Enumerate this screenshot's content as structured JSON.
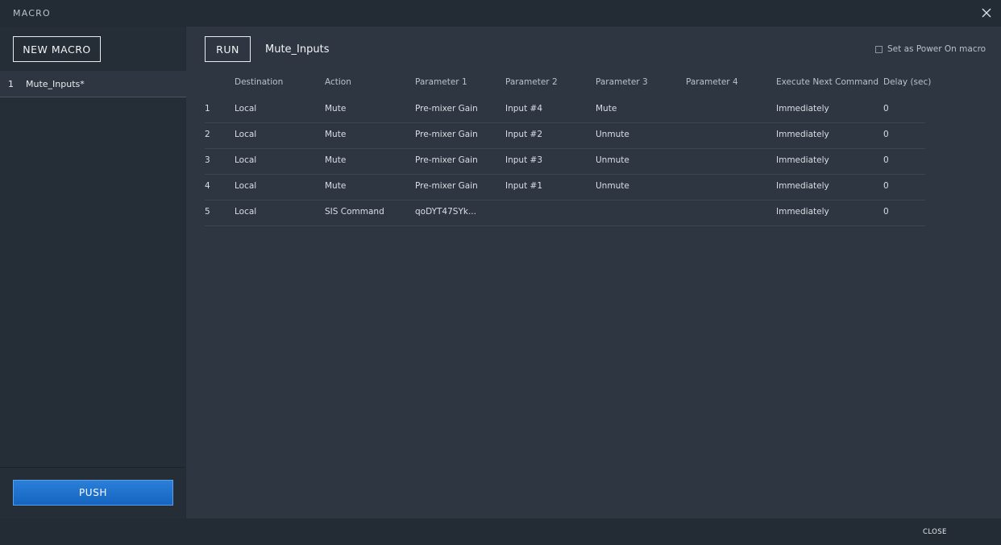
{
  "window": {
    "title": "MACRO",
    "close_icon": "close-icon"
  },
  "sidebar": {
    "new_macro_label": "NEW MACRO",
    "items": [
      {
        "num": "1",
        "name": "Mute_Inputs*"
      }
    ],
    "push_label": "PUSH"
  },
  "main": {
    "run_label": "RUN",
    "macro_name": "Mute_Inputs",
    "power_on_label": "Set as Power On macro",
    "power_on_checked": false,
    "columns": [
      "",
      "Destination",
      "Action",
      "Parameter 1",
      "Parameter 2",
      "Parameter 3",
      "Parameter 4",
      "Execute Next Command",
      "Delay (sec)"
    ],
    "rows": [
      [
        "1",
        "Local",
        "Mute",
        "Pre-mixer Gain",
        "Input #4",
        "Mute",
        "",
        "Immediately",
        "0"
      ],
      [
        "2",
        "Local",
        "Mute",
        "Pre-mixer Gain",
        "Input #2",
        "Unmute",
        "",
        "Immediately",
        "0"
      ],
      [
        "3",
        "Local",
        "Mute",
        "Pre-mixer Gain",
        "Input #3",
        "Unmute",
        "",
        "Immediately",
        "0"
      ],
      [
        "4",
        "Local",
        "Mute",
        "Pre-mixer Gain",
        "Input #1",
        "Unmute",
        "",
        "Immediately",
        "0"
      ],
      [
        "5",
        "Local",
        "SIS Command",
        "qoDYT47SYk...",
        "",
        "",
        "",
        "Immediately",
        "0"
      ]
    ]
  },
  "footer": {
    "close_label": "CLOSE"
  },
  "colors": {
    "background": "#232b35",
    "panel": "#2e3741",
    "accent": "#1e74d4"
  }
}
